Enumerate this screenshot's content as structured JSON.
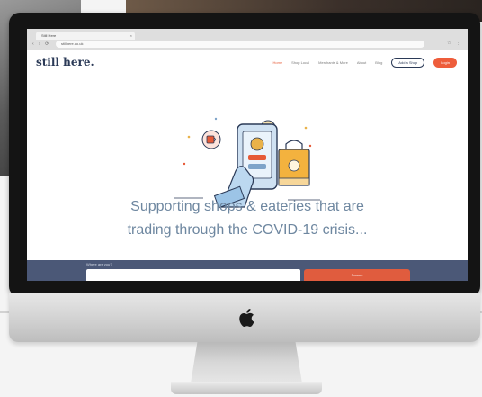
{
  "browser": {
    "tab_title": "Still Here",
    "address": "stillhere.co.uk"
  },
  "site": {
    "logo": "still here.",
    "nav": [
      "Home",
      "Shop Local",
      "Merchants & More",
      "About",
      "Blog"
    ],
    "add_shop": "Add a Shop",
    "cta": "Login"
  },
  "hero": {
    "line1": "Supporting shops & eateries that are",
    "line2": "trading through the COVID-19 crisis..."
  },
  "search": {
    "label": "Where are you?",
    "placeholder": "",
    "button": "Search"
  },
  "colors": {
    "brand_navy": "#2b3a57",
    "accent_orange": "#ee5d3b",
    "headline_blue": "#6e87a0",
    "band": "#4b5877"
  }
}
